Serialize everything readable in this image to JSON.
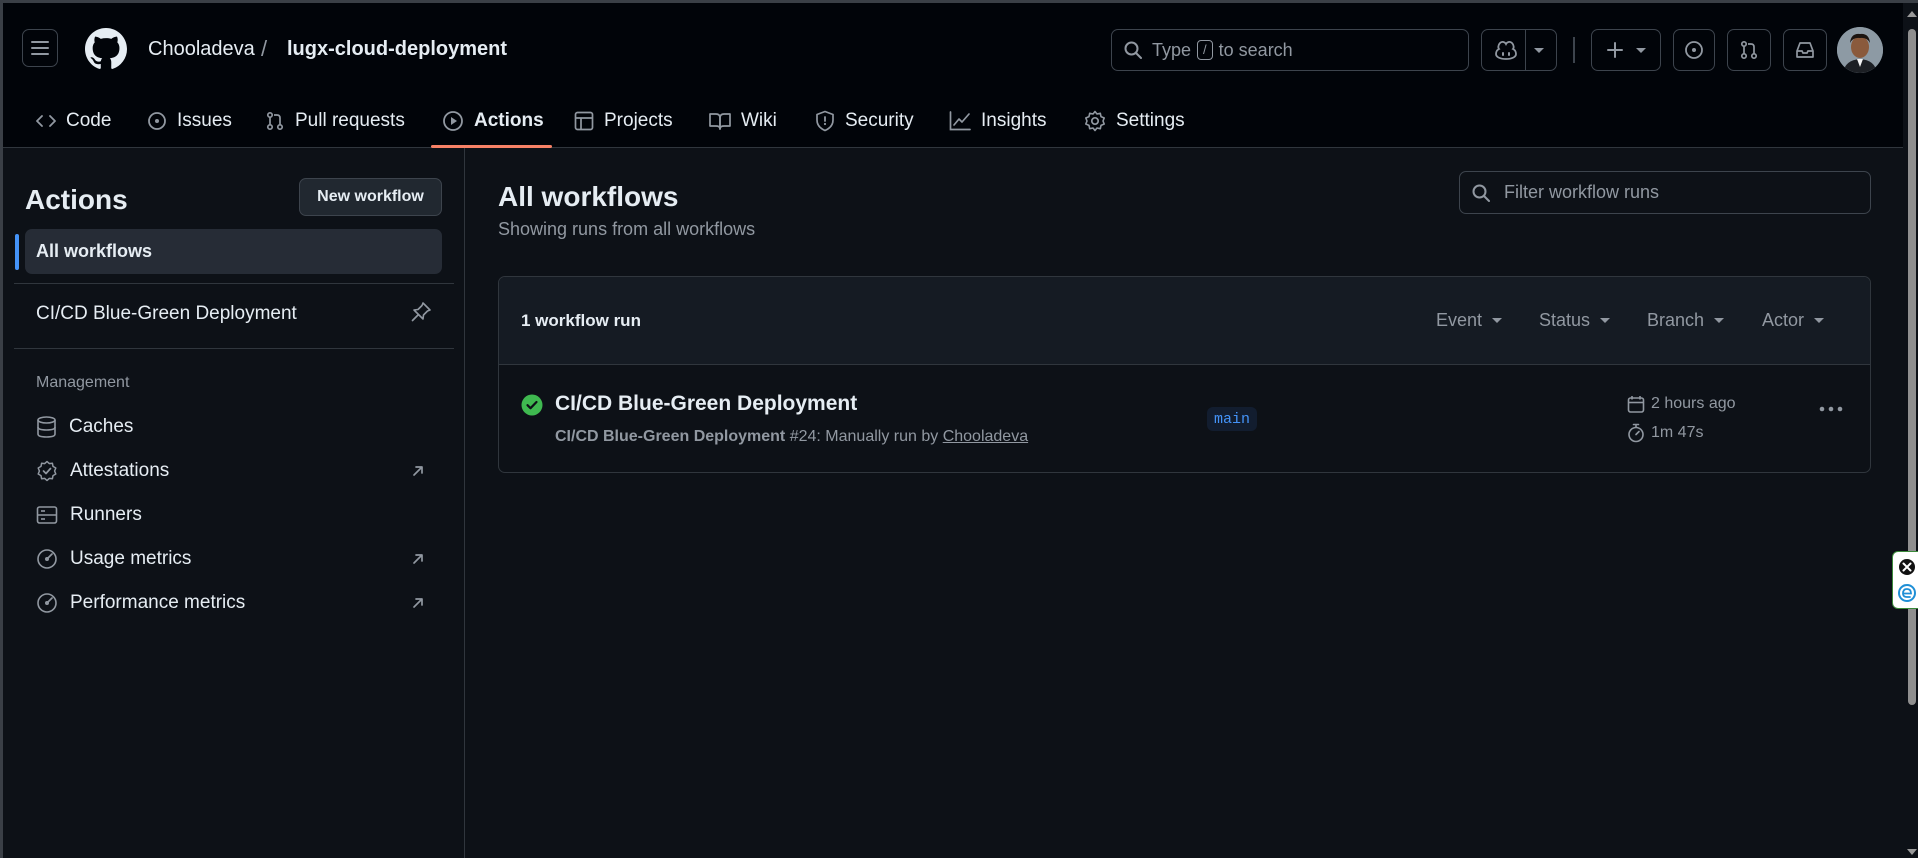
{
  "header": {
    "owner": "Chooladeva",
    "separator": "/",
    "repo": "lugx-cloud-deployment",
    "search_prefix": "Type",
    "search_key": "/",
    "search_suffix": "to search"
  },
  "tabs": [
    {
      "label": "Code",
      "icon": "code-icon"
    },
    {
      "label": "Issues",
      "icon": "issue-opened-icon"
    },
    {
      "label": "Pull requests",
      "icon": "git-pull-request-icon"
    },
    {
      "label": "Actions",
      "icon": "play-icon",
      "active": true
    },
    {
      "label": "Projects",
      "icon": "table-icon"
    },
    {
      "label": "Wiki",
      "icon": "book-icon"
    },
    {
      "label": "Security",
      "icon": "shield-icon"
    },
    {
      "label": "Insights",
      "icon": "graph-icon"
    },
    {
      "label": "Settings",
      "icon": "gear-icon"
    }
  ],
  "sidebar": {
    "title": "Actions",
    "new_workflow": "New workflow",
    "all_workflows": "All workflows",
    "workflows": [
      "CI/CD Blue-Green Deployment"
    ],
    "management_label": "Management",
    "management": [
      {
        "label": "Caches",
        "icon": "database-icon",
        "external": false
      },
      {
        "label": "Attestations",
        "icon": "verified-icon",
        "external": true
      },
      {
        "label": "Runners",
        "icon": "server-icon",
        "external": false
      },
      {
        "label": "Usage metrics",
        "icon": "meter-icon",
        "external": true
      },
      {
        "label": "Performance metrics",
        "icon": "meter-icon",
        "external": true
      }
    ]
  },
  "main": {
    "title": "All workflows",
    "subtitle": "Showing runs from all workflows",
    "filter_placeholder": "Filter workflow runs",
    "runs_count": "1 workflow run",
    "filters": [
      "Event",
      "Status",
      "Branch",
      "Actor"
    ],
    "run": {
      "title": "CI/CD Blue-Green Deployment",
      "workflow_name": "CI/CD Blue-Green Deployment",
      "run_suffix": "#24: Manually run by",
      "actor": "Chooladeva",
      "branch": "main",
      "time_ago": "2 hours ago",
      "duration": "1m 47s",
      "status": "success"
    }
  },
  "colors": {
    "header_bg": "#010409",
    "page_bg": "#0d1117",
    "active_tab_underline": "#f78166",
    "success": "#3fb950",
    "accent": "#4493f8"
  }
}
